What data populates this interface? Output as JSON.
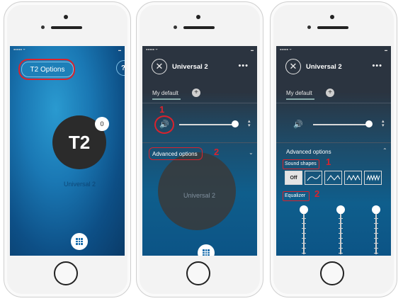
{
  "phone1": {
    "options_button": "T2 Options",
    "partial_icon": "?",
    "avatar": "T2",
    "badge": "0",
    "program_name": "Universal 2",
    "grid_icon": "grid-icon"
  },
  "phone2": {
    "title": "Universal 2",
    "more": "•••",
    "close": "✕",
    "tab": "My default",
    "plus": "+",
    "speaker": "🔊",
    "stepper": "◆",
    "advanced": "Advanced options",
    "chevron": "⌄",
    "num1": "1",
    "num2": "2",
    "program_name": "Universal 2"
  },
  "phone3": {
    "title": "Universal 2",
    "more": "•••",
    "close": "✕",
    "tab": "My default",
    "plus": "+",
    "speaker": "🔊",
    "stepper": "◆",
    "advanced": "Advanced options",
    "chevron": "⌃",
    "sound_shapes": "Sound shapes",
    "equalizer": "Equalizer",
    "off": "Off",
    "num1": "1",
    "num2": "2",
    "equalizer_levels": [
      0.95,
      0.95,
      0.95
    ]
  },
  "colors": {
    "annotation_red": "#d9232d",
    "accent_blue": "#1b6fae"
  }
}
